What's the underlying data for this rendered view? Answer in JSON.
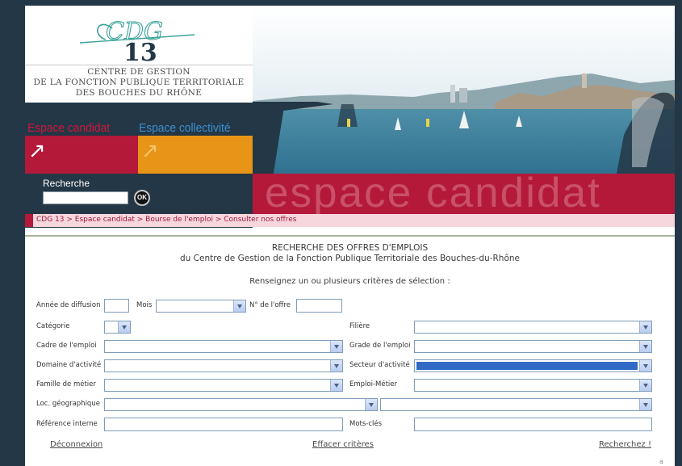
{
  "logo": {
    "line1": "CENTRE DE GESTION",
    "line2": "DE LA FONCTION PUBLIQUE TERRITORIALE",
    "line3": "DES BOUCHES DU RHÔNE"
  },
  "nav": {
    "candidat_label": "Espace candidat",
    "collectivite_label": "Espace collectivité",
    "arrow_icon": "arrow-northeast-icon"
  },
  "search": {
    "label": "Recherche",
    "value": "",
    "ok_label": "OK"
  },
  "banner": {
    "text": "espace candidat"
  },
  "breadcrumb": {
    "items": [
      "CDG 13",
      "Espace candidat",
      "Bourse de l'emploi",
      "Consulter nos offres"
    ],
    "separator": ">"
  },
  "form": {
    "title_line1": "RECHERCHE DES OFFRES D'EMPLOIS",
    "title_line2": "du Centre de Gestion de la Fonction Publique Territoriale des Bouches-du-Rhône",
    "subtitle": "Renseignez un ou plusieurs critères de sélection :",
    "annee_label": "Année de diffusion",
    "mois_label": "Mois",
    "num_offre_label": "N° de l'offre",
    "categorie_label": "Catégorie",
    "filiere_label": "Filière",
    "cadre_label": "Cadre de l'emploi",
    "grade_label": "Grade de l'emploi",
    "domaine_label": "Domaine d'activité",
    "secteur_label": "Secteur d'activité",
    "famille_label": "Famille de métier",
    "emploi_label": "Emploi-Métier",
    "loc_label": "Loc. géographique",
    "reference_label": "Référence interne",
    "mots_label": "Mots-clés"
  },
  "actions": {
    "deconnexion": "Déconnexion",
    "effacer": "Effacer critères",
    "rechercher": "Recherchez !"
  },
  "footer_mark": "a",
  "colors": {
    "navy": "#243746",
    "crimson": "#b4193a",
    "orange": "#e89416",
    "select_highlight": "#316ac5"
  }
}
